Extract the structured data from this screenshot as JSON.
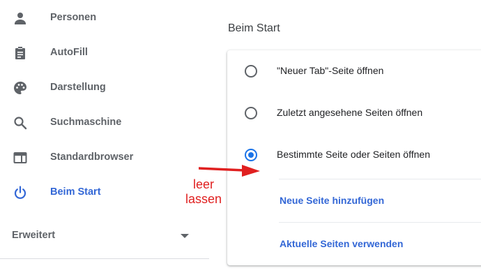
{
  "sidebar": {
    "items": [
      {
        "label": "Personen",
        "icon": "person-icon"
      },
      {
        "label": "AutoFill",
        "icon": "clipboard-icon"
      },
      {
        "label": "Darstellung",
        "icon": "palette-icon"
      },
      {
        "label": "Suchmaschine",
        "icon": "search-icon"
      },
      {
        "label": "Standardbrowser",
        "icon": "browser-window-icon"
      },
      {
        "label": "Beim Start",
        "icon": "power-icon",
        "active": true
      }
    ],
    "advanced_label": "Erweitert"
  },
  "main": {
    "section_title": "Beim Start",
    "options": [
      {
        "label": "\"Neuer Tab\"-Seite öffnen",
        "checked": false
      },
      {
        "label": "Zuletzt angesehene Seiten öffnen",
        "checked": false
      },
      {
        "label": "Bestimmte Seite oder Seiten öffnen",
        "checked": true
      }
    ],
    "add_page_link": "Neue Seite hinzufügen",
    "use_current_link": "Aktuelle Seiten verwenden"
  },
  "annotation": {
    "line1": "leer",
    "line2": "lassen"
  },
  "colors": {
    "accent": "#1a73e8",
    "link": "#3367d6",
    "annotation": "#e02020",
    "text_secondary": "#5f6368"
  }
}
